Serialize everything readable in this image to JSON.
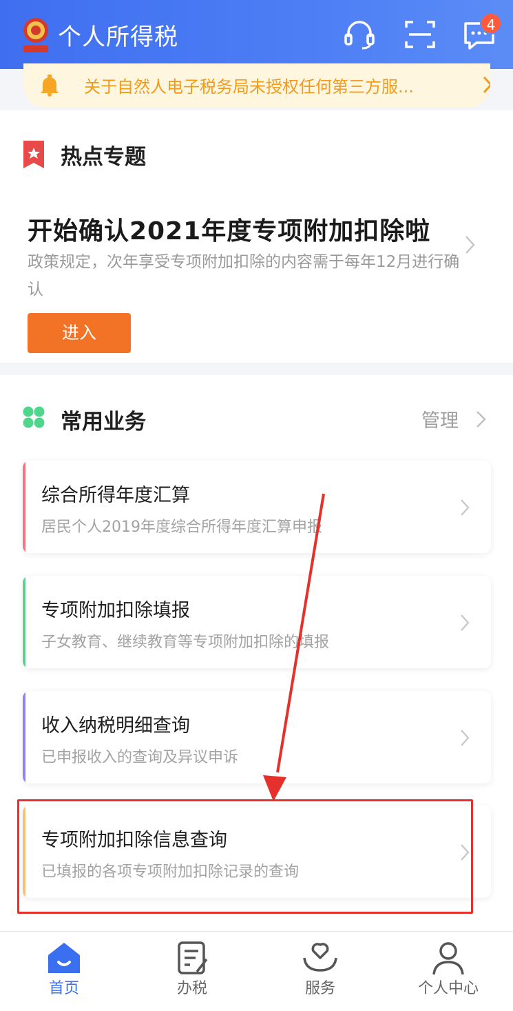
{
  "header": {
    "title": "个人所得税",
    "notification_count": "4",
    "icons": [
      "customer-service-icon",
      "scan-icon",
      "message-icon"
    ]
  },
  "notice": {
    "text": "关于自然人电子税务局未授权任何第三方服..."
  },
  "hot_topics": {
    "section_title": "热点专题",
    "topic_title": "开始确认2021年度专项附加扣除啦",
    "topic_desc": "政策规定，次年享受专项附加扣除的内容需于每年12月进行确认",
    "enter_label": "进入"
  },
  "common_services": {
    "section_title": "常用业务",
    "manage_label": "管理",
    "items": [
      {
        "title": "综合所得年度汇算",
        "subtitle": "居民个人2019年度综合所得年度汇算申报",
        "accent": "#f0758a"
      },
      {
        "title": "专项附加扣除填报",
        "subtitle": "子女教育、继续教育等专项附加扣除的填报",
        "accent": "#5fcf8c"
      },
      {
        "title": "收入纳税明细查询",
        "subtitle": "已申报收入的查询及异议申诉",
        "accent": "#8b86e8"
      },
      {
        "title": "专项附加扣除信息查询",
        "subtitle": "已填报的各项专项附加扣除记录的查询",
        "accent": "#f2c27a"
      }
    ]
  },
  "tabbar": {
    "tabs": [
      {
        "label": "首页",
        "icon": "home-icon",
        "active": true
      },
      {
        "label": "办税",
        "icon": "tax-form-icon",
        "active": false
      },
      {
        "label": "服务",
        "icon": "service-heart-icon",
        "active": false
      },
      {
        "label": "个人中心",
        "icon": "user-icon",
        "active": false
      }
    ]
  },
  "colors": {
    "header_blue": "#4d7ef5",
    "enter_orange": "#f27326",
    "notice_text": "#f29a1a",
    "highlight_red": "#e5302b",
    "active_tab": "#3a6ff0"
  }
}
